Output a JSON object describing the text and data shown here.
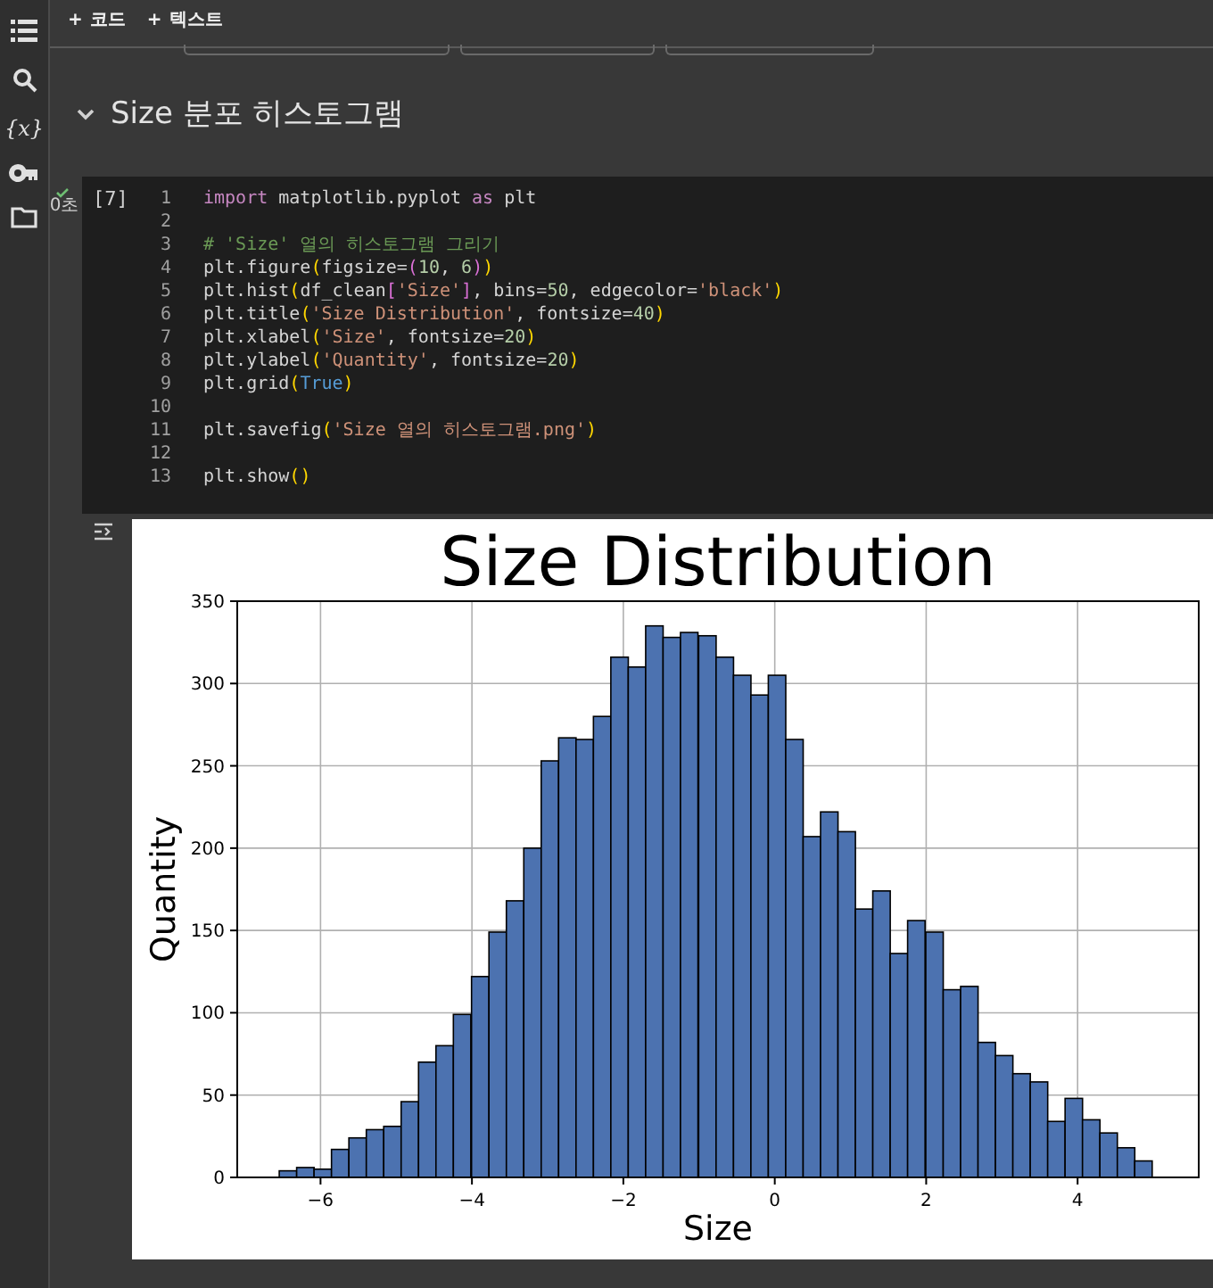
{
  "toolbar": {
    "buttons": [
      {
        "icon": "+",
        "label": "코드"
      },
      {
        "icon": "+",
        "label": "텍스트"
      }
    ]
  },
  "sidebar": {
    "variables_glyph": "{x}"
  },
  "section": {
    "title": "Size 분포 히스토그램",
    "expanded": true
  },
  "code_cell": {
    "execution_count": "[7]",
    "succeeded": true,
    "duration": "0초",
    "lines": [
      {
        "number": "1",
        "tokens": [
          {
            "kind": "keyword",
            "text": "import"
          },
          {
            "kind": "plain",
            "text": " matplotlib.pyplot "
          },
          {
            "kind": "keyword",
            "text": "as"
          },
          {
            "kind": "plain",
            "text": " plt"
          }
        ]
      },
      {
        "number": "2"
      },
      {
        "number": "3",
        "tokens": [
          {
            "kind": "comment",
            "text": "# 'Size' 열의 히스토그램 그리기"
          }
        ]
      },
      {
        "number": "4",
        "tokens": [
          {
            "kind": "plain",
            "text": "plt.figure"
          },
          {
            "kind": "bracket",
            "text": "("
          },
          {
            "kind": "plain",
            "text": "figsize="
          },
          {
            "kind": "bracket2",
            "text": "("
          },
          {
            "kind": "number",
            "text": "10"
          },
          {
            "kind": "plain",
            "text": ", "
          },
          {
            "kind": "number",
            "text": "6"
          },
          {
            "kind": "bracket2",
            "text": ")"
          },
          {
            "kind": "bracket",
            "text": ")"
          }
        ]
      },
      {
        "number": "5",
        "tokens": [
          {
            "kind": "plain",
            "text": "plt.hist"
          },
          {
            "kind": "bracket",
            "text": "("
          },
          {
            "kind": "plain",
            "text": "df_clean"
          },
          {
            "kind": "bracket2",
            "text": "["
          },
          {
            "kind": "string",
            "text": "'Size'"
          },
          {
            "kind": "bracket2",
            "text": "]"
          },
          {
            "kind": "plain",
            "text": ", bins="
          },
          {
            "kind": "number",
            "text": "50"
          },
          {
            "kind": "plain",
            "text": ", edgecolor="
          },
          {
            "kind": "string",
            "text": "'black'"
          },
          {
            "kind": "bracket",
            "text": ")"
          }
        ]
      },
      {
        "number": "6",
        "tokens": [
          {
            "kind": "plain",
            "text": "plt.title"
          },
          {
            "kind": "bracket",
            "text": "("
          },
          {
            "kind": "string",
            "text": "'Size Distribution'"
          },
          {
            "kind": "plain",
            "text": ", fontsize="
          },
          {
            "kind": "number",
            "text": "40"
          },
          {
            "kind": "bracket",
            "text": ")"
          }
        ]
      },
      {
        "number": "7",
        "tokens": [
          {
            "kind": "plain",
            "text": "plt.xlabel"
          },
          {
            "kind": "bracket",
            "text": "("
          },
          {
            "kind": "string",
            "text": "'Size'"
          },
          {
            "kind": "plain",
            "text": ", fontsize="
          },
          {
            "kind": "number",
            "text": "20"
          },
          {
            "kind": "bracket",
            "text": ")"
          }
        ]
      },
      {
        "number": "8",
        "tokens": [
          {
            "kind": "plain",
            "text": "plt.ylabel"
          },
          {
            "kind": "bracket",
            "text": "("
          },
          {
            "kind": "string",
            "text": "'Quantity'"
          },
          {
            "kind": "plain",
            "text": ", fontsize="
          },
          {
            "kind": "number",
            "text": "20"
          },
          {
            "kind": "bracket",
            "text": ")"
          }
        ]
      },
      {
        "number": "9",
        "tokens": [
          {
            "kind": "plain",
            "text": "plt.grid"
          },
          {
            "kind": "bracket",
            "text": "("
          },
          {
            "kind": "constant",
            "text": "True"
          },
          {
            "kind": "bracket",
            "text": ")"
          }
        ]
      },
      {
        "number": "10"
      },
      {
        "number": "11",
        "tokens": [
          {
            "kind": "plain",
            "text": "plt.savefig"
          },
          {
            "kind": "bracket",
            "text": "("
          },
          {
            "kind": "string",
            "text": "'Size 열의 히스토그램.png'"
          },
          {
            "kind": "bracket",
            "text": ")"
          }
        ]
      },
      {
        "number": "12"
      },
      {
        "number": "13",
        "tokens": [
          {
            "kind": "plain",
            "text": "plt.show"
          },
          {
            "kind": "bracket",
            "text": "()"
          }
        ]
      }
    ]
  },
  "output": {
    "chart_data": {
      "type": "bar",
      "title": "Size Distribution",
      "xlabel": "Size",
      "ylabel": "Quantity",
      "x": [
        -6.43,
        -6.2,
        -5.97,
        -5.74,
        -5.51,
        -5.28,
        -5.05,
        -4.82,
        -4.59,
        -4.36,
        -4.13,
        -3.89,
        -3.66,
        -3.43,
        -3.2,
        -2.97,
        -2.74,
        -2.51,
        -2.28,
        -2.05,
        -1.82,
        -1.59,
        -1.36,
        -1.13,
        -0.89,
        -0.66,
        -0.43,
        -0.2,
        0.03,
        0.26,
        0.49,
        0.72,
        0.95,
        1.18,
        1.41,
        1.64,
        1.87,
        2.11,
        2.34,
        2.57,
        2.8,
        3.03,
        3.26,
        3.49,
        3.72,
        3.95,
        4.18,
        4.41,
        4.64,
        4.87
      ],
      "values": [
        4,
        6,
        5,
        17,
        24,
        29,
        31,
        46,
        70,
        80,
        99,
        122,
        149,
        168,
        200,
        253,
        267,
        266,
        280,
        316,
        310,
        335,
        328,
        331,
        329,
        316,
        305,
        293,
        305,
        266,
        207,
        222,
        210,
        163,
        174,
        136,
        156,
        149,
        114,
        116,
        82,
        74,
        63,
        58,
        34,
        48,
        35,
        27,
        18,
        10
      ],
      "grid": true,
      "xlim": [
        -7.1,
        5.6
      ],
      "ylim": [
        0,
        350
      ],
      "xticks": [
        {
          "value": -6,
          "label": "−6"
        },
        {
          "value": -4,
          "label": "−4"
        },
        {
          "value": -2,
          "label": "−2"
        },
        {
          "value": 0,
          "label": "0"
        },
        {
          "value": 2,
          "label": "2"
        },
        {
          "value": 4,
          "label": "4"
        }
      ],
      "yticks": [
        0,
        50,
        100,
        150,
        200,
        250,
        300,
        350
      ]
    }
  }
}
